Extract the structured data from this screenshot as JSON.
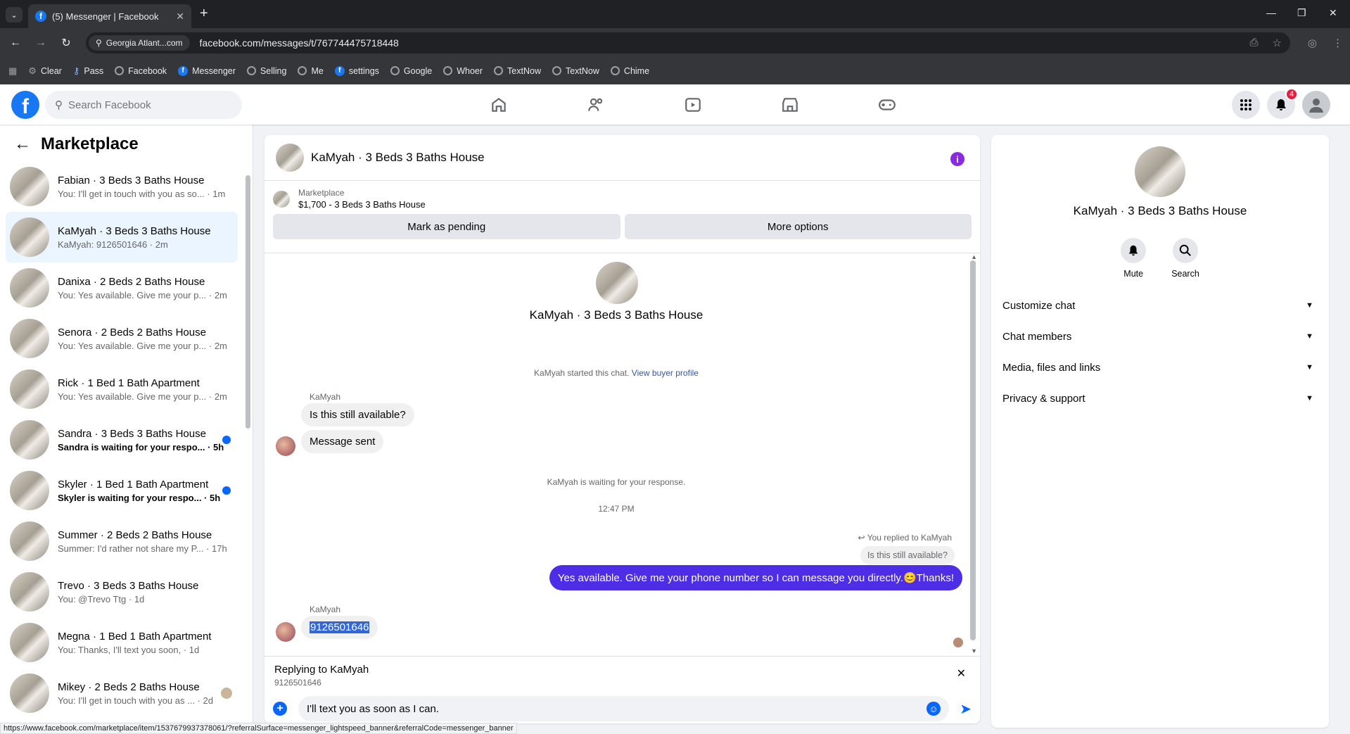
{
  "browser": {
    "tab_title": "(5) Messenger | Facebook",
    "site_chip": "Georgia Atlant...com",
    "url": "facebook.com/messages/t/767744475718448",
    "bookmarks": [
      "Clear",
      "Pass",
      "Facebook",
      "Messenger",
      "Selling",
      "Me",
      "settings",
      "Google",
      "Whoer",
      "TextNow",
      "TextNow",
      "Chime"
    ],
    "status_url": "https://www.facebook.com/marketplace/item/1537679937378061/?referralSurface=messenger_lightspeed_banner&referralCode=messenger_banner"
  },
  "header": {
    "search_placeholder": "Search Facebook",
    "notifications_count": "4"
  },
  "left": {
    "title": "Marketplace",
    "conversations": [
      {
        "name": "Fabian · 3 Beds 3 Baths House",
        "preview": "You: I'll get in touch with you as so... · 1m"
      },
      {
        "name": "KaMyah · 3 Beds 3 Baths House",
        "preview": "KaMyah: 9126501646 · 2m"
      },
      {
        "name": "Danixa · 2 Beds 2 Baths House",
        "preview": "You: Yes available. Give me your p... · 2m"
      },
      {
        "name": "Senora · 2 Beds 2 Baths House",
        "preview": "You: Yes available. Give me your p... · 2m"
      },
      {
        "name": "Rick · 1 Bed 1 Bath Apartment",
        "preview": "You: Yes available. Give me your p... · 2m"
      },
      {
        "name": "Sandra · 3 Beds 3 Baths House",
        "preview": "Sandra is waiting for your respo... · 5h"
      },
      {
        "name": "Skyler · 1 Bed 1 Bath Apartment",
        "preview": "Skyler is waiting for your respo... · 5h"
      },
      {
        "name": "Summer · 2 Beds 2 Baths House",
        "preview": "Summer: I'd rather not share my P... · 17h"
      },
      {
        "name": "Trevo · 3 Beds 3 Baths House",
        "preview": "You: @Trevo Ttg · 1d"
      },
      {
        "name": "Megna · 1 Bed 1 Bath Apartment",
        "preview": "You: Thanks, I'll text you soon, · 1d"
      },
      {
        "name": "Mikey · 2 Beds 2 Baths House",
        "preview": "You: I'll get in touch with you as ... · 2d"
      }
    ]
  },
  "chat": {
    "title": "KaMyah · 3 Beds 3 Baths House",
    "marketplace_label": "Marketplace",
    "listing": "$1,700 - 3 Beds 3 Baths House",
    "mark_pending": "Mark as pending",
    "more_options": "More options",
    "started_text": "KaMyah started this chat.",
    "view_buyer": "View buyer profile",
    "sender": "KaMyah",
    "msg1": "Is this still available?",
    "msg2": "Message sent",
    "waiting": "KaMyah is waiting for your response.",
    "time": "12:47 PM",
    "replied_note": "You replied to KaMyah",
    "quoted": "Is this still available?",
    "outgoing": "Yes available. Give me your phone number so I can message you directly.😊Thanks!",
    "phone_msg": "9126501646",
    "replying_to": "Replying to KaMyah",
    "replying_value": "9126501646",
    "input_value": "I'll text you as soon as I can."
  },
  "details": {
    "name": "KaMyah · 3 Beds 3 Baths House",
    "mute": "Mute",
    "search": "Search",
    "sections": [
      "Customize chat",
      "Chat members",
      "Media, files and links",
      "Privacy & support"
    ]
  }
}
